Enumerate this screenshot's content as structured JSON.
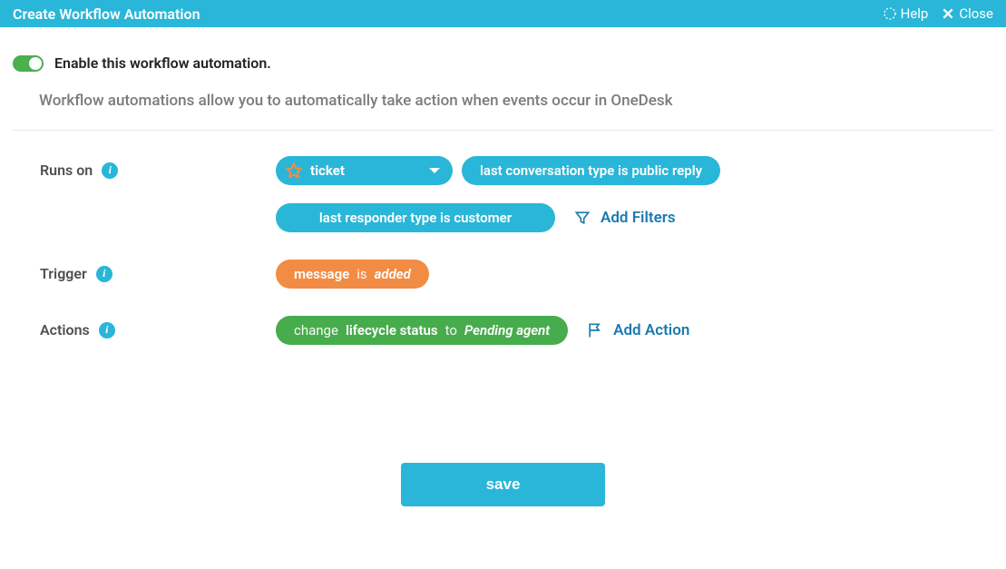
{
  "header": {
    "title": "Create Workflow Automation",
    "help": "Help",
    "close": "Close"
  },
  "toggle": {
    "label": "Enable this workflow automation."
  },
  "description": "Workflow automations allow you to automatically take action when events occur in OneDesk",
  "rows": {
    "runs_on": {
      "label": "Runs on",
      "type_select": "ticket",
      "filter1": "last conversation type is public reply",
      "filter2": "last responder type is customer",
      "add_filters": "Add Filters"
    },
    "trigger": {
      "label": "Trigger",
      "subject": "message",
      "verb": "is",
      "state": "added"
    },
    "actions": {
      "label": "Actions",
      "verb": "change",
      "field": "lifecycle status",
      "prep": "to",
      "value": "Pending agent",
      "add_action": "Add Action"
    }
  },
  "buttons": {
    "save": "save"
  }
}
